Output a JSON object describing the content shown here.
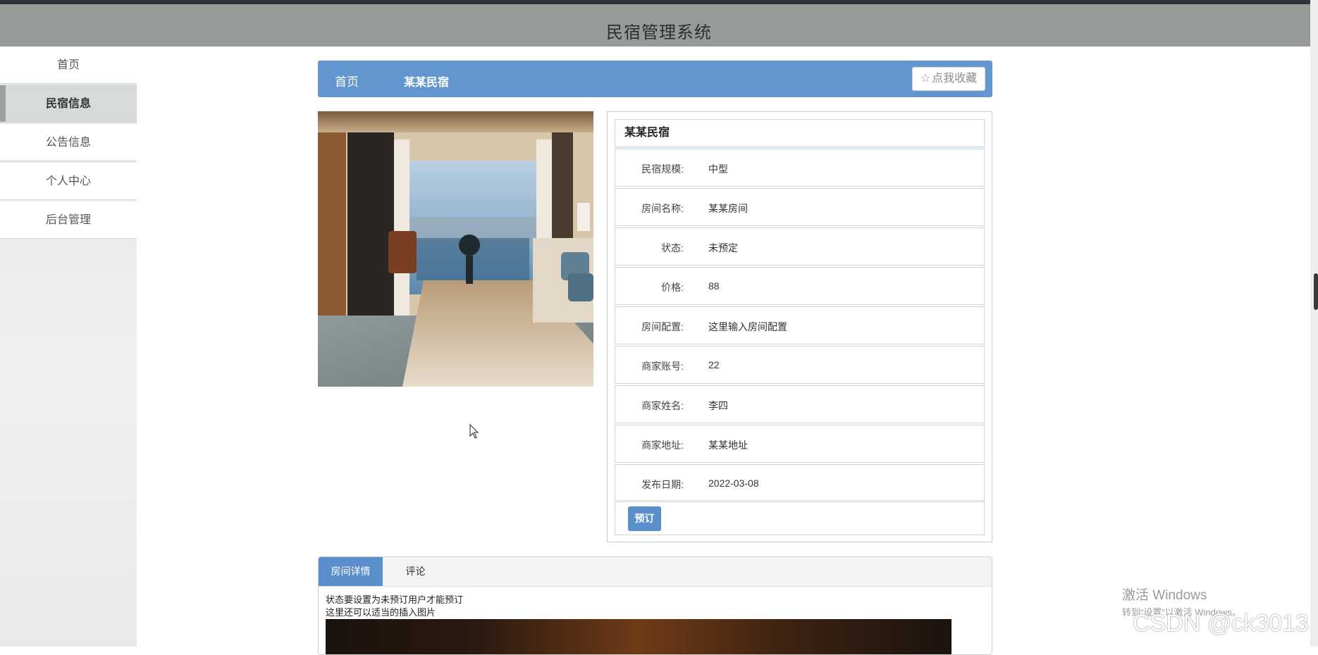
{
  "header": {
    "title": "民宿管理系统"
  },
  "sidebar": {
    "items": [
      {
        "label": "首页"
      },
      {
        "label": "民宿信息"
      },
      {
        "label": "公告信息"
      },
      {
        "label": "个人中心"
      },
      {
        "label": "后台管理"
      }
    ],
    "active_index": 1
  },
  "breadcrumb": {
    "home": "首页",
    "current": "某某民宿",
    "favorite_label": "点我收藏",
    "favorite_icon": "star-outline-icon"
  },
  "detail": {
    "name": "某某民宿",
    "fields": [
      {
        "label": "民宿规模:",
        "value": "中型"
      },
      {
        "label": "房间名称:",
        "value": "某某房间"
      },
      {
        "label": "状态:",
        "value": "未预定"
      },
      {
        "label": "价格:",
        "value": "88"
      },
      {
        "label": "房间配置:",
        "value": "这里输入房间配置"
      },
      {
        "label": "商家账号:",
        "value": "22"
      },
      {
        "label": "商家姓名:",
        "value": "李四"
      },
      {
        "label": "商家地址:",
        "value": "某某地址"
      },
      {
        "label": "发布日期:",
        "value": "2022-03-08"
      }
    ],
    "book_label": "预订"
  },
  "tabs": {
    "items": [
      {
        "label": "房间详情"
      },
      {
        "label": "评论"
      }
    ],
    "active_index": 0,
    "content_lines": [
      "状态要设置为未预订用户才能预订",
      "这里还可以适当的插入图片"
    ]
  },
  "overlay": {
    "windows_activation_line1": "激活 Windows",
    "windows_activation_line2": "转到“设置”以激活 Windows。",
    "watermark": "CSDN @ck3013"
  },
  "colors": {
    "header_bg": "#979b98",
    "accent_blue": "#6395ce",
    "button_blue": "#5b8fcb",
    "active_menu": "#d6dbd8"
  }
}
